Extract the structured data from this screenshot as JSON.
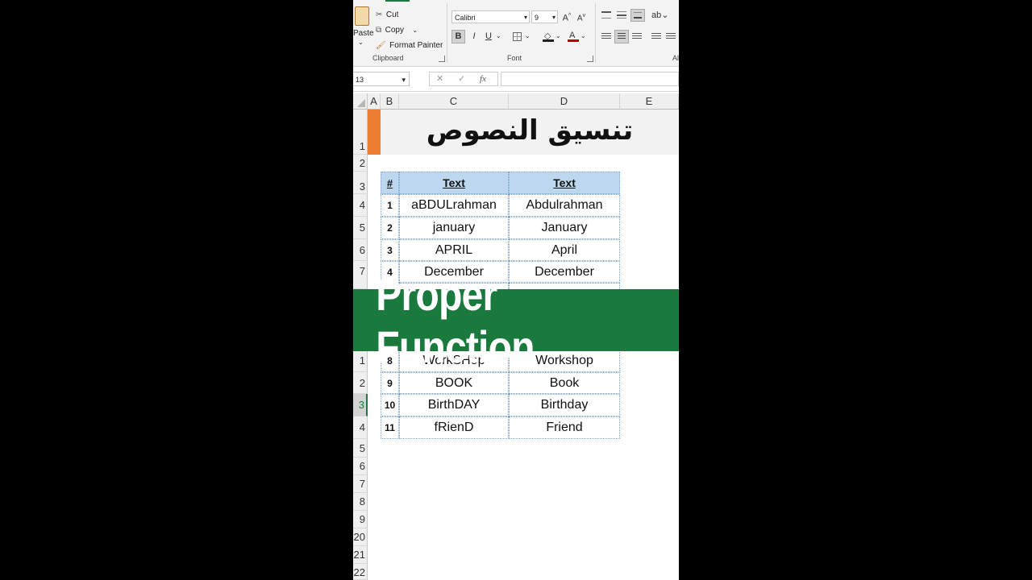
{
  "ribbon": {
    "clipboard": {
      "paste_label": "Paste",
      "cut_label": "Cut",
      "copy_label": "Copy",
      "format_painter_label": "Format Painter",
      "group_label": "Clipboard"
    },
    "font": {
      "font_name": "Calibri",
      "font_size": "9",
      "group_label": "Font",
      "bold": "B",
      "italic": "I",
      "underline": "U"
    },
    "alignment": {
      "group_label_partial": "Al"
    }
  },
  "formula_bar": {
    "name_box": "13",
    "cancel": "✕",
    "enter": "✓",
    "fx": "fx",
    "content": ""
  },
  "columns": [
    "A",
    "B",
    "C",
    "D",
    "E"
  ],
  "rows_visible_top": [
    "1",
    "2",
    "3",
    "4",
    "5",
    "6",
    "7"
  ],
  "rows_visible_bottom": [
    "1",
    "2",
    "3",
    "4",
    "5",
    "6",
    "7",
    "8",
    "9",
    "20",
    "21",
    "22"
  ],
  "sheet": {
    "title": "تنسيق النصوص",
    "table_header": {
      "num": "#",
      "col_c": "Text",
      "col_d": "Text"
    },
    "rows": [
      {
        "n": "1",
        "c": "aBDULrahman",
        "d": "Abdulrahman"
      },
      {
        "n": "2",
        "c": "january",
        "d": "January"
      },
      {
        "n": "3",
        "c": "APRIL",
        "d": "April"
      },
      {
        "n": "4",
        "c": "December",
        "d": "December"
      },
      {
        "n": "8",
        "c": "WorkSHop",
        "d": "Workshop"
      },
      {
        "n": "9",
        "c": "BOOK",
        "d": "Book"
      },
      {
        "n": "10",
        "c": "BirthDAY",
        "d": "Birthday"
      },
      {
        "n": "11",
        "c": "fRienD",
        "d": "Friend"
      }
    ]
  },
  "banner": {
    "text": "Proper Function"
  },
  "colors": {
    "accent_green": "#1a7a3e",
    "header_fill": "#bdd7ee",
    "orange_bar": "#ed7d31"
  }
}
